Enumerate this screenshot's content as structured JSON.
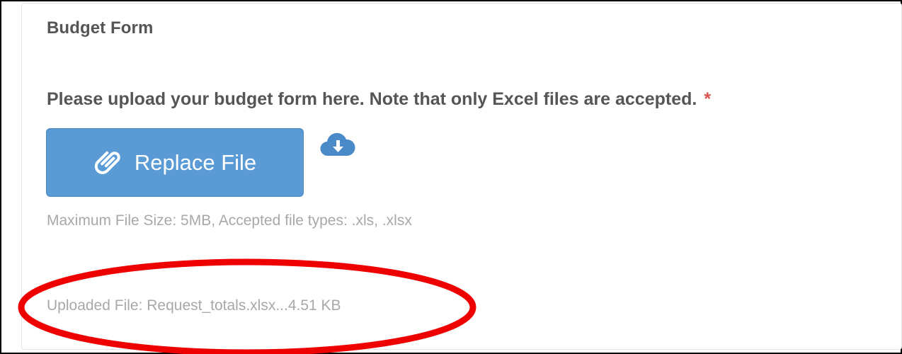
{
  "form": {
    "section_title": "Budget Form",
    "question_label": "Please upload your budget form here. Note that only Excel files are accepted.",
    "required_marker": "*",
    "upload_button_label": "Replace File",
    "upload_icon": "paperclip-icon",
    "download_icon": "cloud-download-icon",
    "help_text": "Maximum File Size: 5MB, Accepted file types: .xls, .xlsx",
    "uploaded_file_text": "Uploaded File: Request_totals.xlsx...4.51 KB"
  },
  "colors": {
    "button_bg": "#5b9bd5",
    "required": "#d9534f",
    "annotation": "#ee0000",
    "muted_text": "#a8a8a8",
    "label_text": "#555555"
  }
}
